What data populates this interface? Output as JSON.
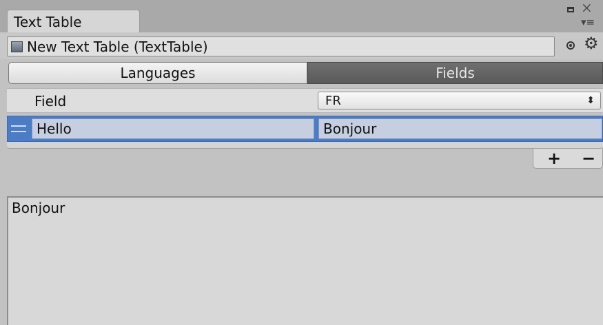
{
  "window": {
    "tab_title": "Text Table"
  },
  "object": {
    "name": "New Text Table (TextTable)"
  },
  "toolbar": {
    "tabs": [
      {
        "label": "Languages",
        "selected": false
      },
      {
        "label": "Fields",
        "selected": true
      }
    ]
  },
  "table": {
    "field_header": "Field",
    "language_select": {
      "value": "FR"
    },
    "rows": [
      {
        "key": "Hello",
        "value": "Bonjour"
      }
    ]
  },
  "footer": {
    "add_label": "+",
    "remove_label": "−"
  },
  "preview": {
    "text": "Bonjour"
  },
  "colors": {
    "selected_row": "#4b7dc6",
    "active_tab": "#5f5f5f"
  }
}
